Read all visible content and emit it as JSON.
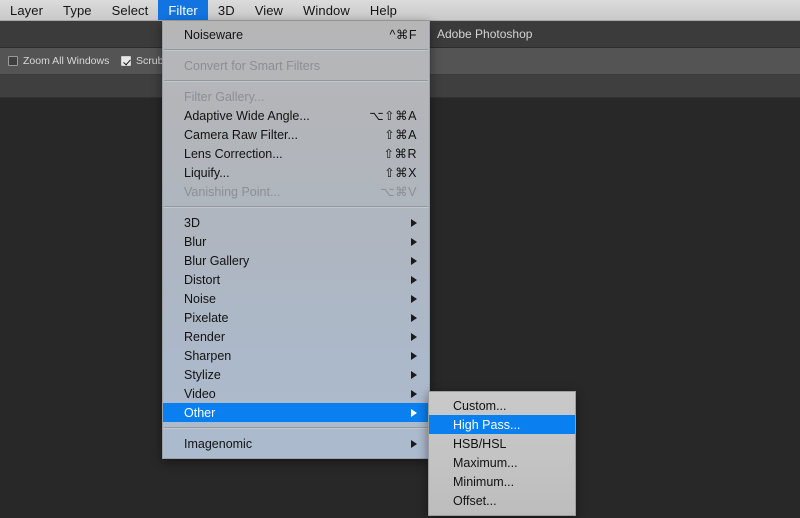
{
  "menubar": {
    "items": [
      {
        "label": "Layer",
        "active": false
      },
      {
        "label": "Type",
        "active": false
      },
      {
        "label": "Select",
        "active": false
      },
      {
        "label": "Filter",
        "active": true
      },
      {
        "label": "3D",
        "active": false
      },
      {
        "label": "View",
        "active": false
      },
      {
        "label": "Window",
        "active": false
      },
      {
        "label": "Help",
        "active": false
      }
    ]
  },
  "window": {
    "title": "Adobe Photoshop"
  },
  "options_bar": {
    "zoom_all_windows": {
      "label": "Zoom All Windows",
      "checked": false
    },
    "scrubby_zoom": {
      "label": "Scrubb",
      "checked": true
    }
  },
  "filter_menu": {
    "groups": [
      {
        "items": [
          {
            "label": "Noiseware",
            "shortcut": "^⌘F",
            "disabled": false,
            "submenu": false,
            "selected": false
          }
        ]
      },
      {
        "items": [
          {
            "label": "Convert for Smart Filters",
            "shortcut": "",
            "disabled": true,
            "submenu": false,
            "selected": false
          }
        ]
      },
      {
        "items": [
          {
            "label": "Filter Gallery...",
            "shortcut": "",
            "disabled": true,
            "submenu": false,
            "selected": false
          },
          {
            "label": "Adaptive Wide Angle...",
            "shortcut": "⌥⇧⌘A",
            "disabled": false,
            "submenu": false,
            "selected": false
          },
          {
            "label": "Camera Raw Filter...",
            "shortcut": "⇧⌘A",
            "disabled": false,
            "submenu": false,
            "selected": false
          },
          {
            "label": "Lens Correction...",
            "shortcut": "⇧⌘R",
            "disabled": false,
            "submenu": false,
            "selected": false
          },
          {
            "label": "Liquify...",
            "shortcut": "⇧⌘X",
            "disabled": false,
            "submenu": false,
            "selected": false
          },
          {
            "label": "Vanishing Point...",
            "shortcut": "⌥⌘V",
            "disabled": true,
            "submenu": false,
            "selected": false
          }
        ]
      },
      {
        "items": [
          {
            "label": "3D",
            "shortcut": "",
            "disabled": false,
            "submenu": true,
            "selected": false
          },
          {
            "label": "Blur",
            "shortcut": "",
            "disabled": false,
            "submenu": true,
            "selected": false
          },
          {
            "label": "Blur Gallery",
            "shortcut": "",
            "disabled": false,
            "submenu": true,
            "selected": false
          },
          {
            "label": "Distort",
            "shortcut": "",
            "disabled": false,
            "submenu": true,
            "selected": false
          },
          {
            "label": "Noise",
            "shortcut": "",
            "disabled": false,
            "submenu": true,
            "selected": false
          },
          {
            "label": "Pixelate",
            "shortcut": "",
            "disabled": false,
            "submenu": true,
            "selected": false
          },
          {
            "label": "Render",
            "shortcut": "",
            "disabled": false,
            "submenu": true,
            "selected": false
          },
          {
            "label": "Sharpen",
            "shortcut": "",
            "disabled": false,
            "submenu": true,
            "selected": false
          },
          {
            "label": "Stylize",
            "shortcut": "",
            "disabled": false,
            "submenu": true,
            "selected": false
          },
          {
            "label": "Video",
            "shortcut": "",
            "disabled": false,
            "submenu": true,
            "selected": false
          },
          {
            "label": "Other",
            "shortcut": "",
            "disabled": false,
            "submenu": true,
            "selected": true
          }
        ]
      },
      {
        "items": [
          {
            "label": "Imagenomic",
            "shortcut": "",
            "disabled": false,
            "submenu": true,
            "selected": false
          }
        ]
      }
    ]
  },
  "other_submenu": {
    "items": [
      {
        "label": "Custom...",
        "selected": false
      },
      {
        "label": "High Pass...",
        "selected": true
      },
      {
        "label": "HSB/HSL",
        "selected": false
      },
      {
        "label": "Maximum...",
        "selected": false
      },
      {
        "label": "Minimum...",
        "selected": false
      },
      {
        "label": "Offset...",
        "selected": false
      }
    ]
  },
  "colors": {
    "highlight": "#0a7ff0",
    "menubar_highlight": "#1274e0",
    "canvas": "#282828",
    "menu_panel_top": "#b6b6b7",
    "menu_panel_bottom": "#abbacd"
  }
}
